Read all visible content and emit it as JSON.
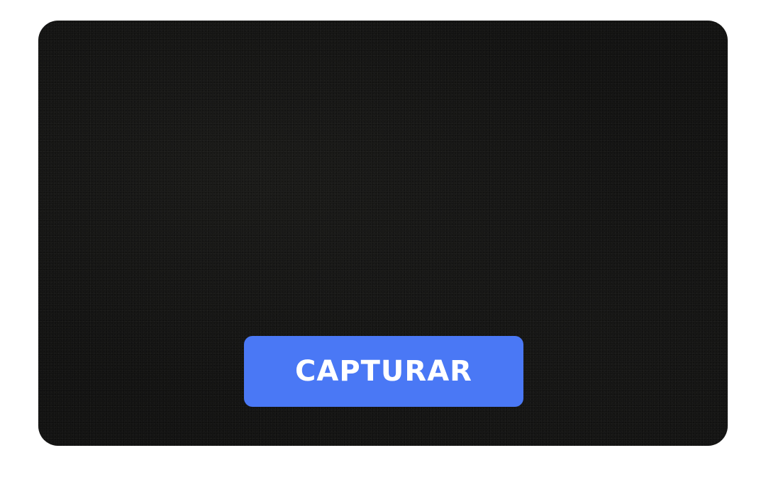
{
  "camera": {
    "capture_label": "CAPTURAR"
  },
  "colors": {
    "page_background": "#ffffff",
    "viewfinder_background": "#111110",
    "button_background": "#4a78f5",
    "button_text": "#ffffff"
  }
}
